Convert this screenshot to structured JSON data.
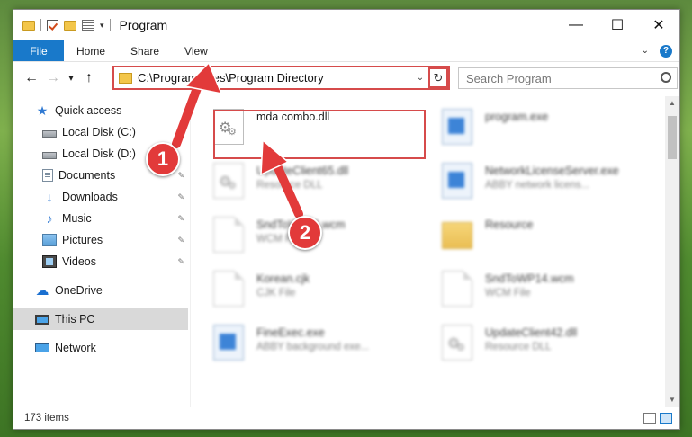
{
  "window": {
    "title": "Program"
  },
  "ribbon": {
    "file": "File",
    "tabs": [
      "Home",
      "Share",
      "View"
    ],
    "help": "?"
  },
  "titlebar": {
    "minimize": "—",
    "maximize": "☐",
    "close": "✕"
  },
  "nav": {
    "back": "←",
    "forward": "→",
    "recent": "▾",
    "up": "↑",
    "address_path": "C:\\Program Files\\Program Directory",
    "address_dropdown": "⌄",
    "refresh": "↻",
    "search_placeholder": "Search Program"
  },
  "sidebar": {
    "items": [
      {
        "label": "Quick access",
        "icon": "star-icon"
      },
      {
        "label": "Local Disk (C:)",
        "icon": "drive-icon"
      },
      {
        "label": "Local Disk (D:)",
        "icon": "drive-icon"
      },
      {
        "label": "Documents",
        "icon": "documents-icon",
        "pinned": true
      },
      {
        "label": "Downloads",
        "icon": "download-icon",
        "pinned": true
      },
      {
        "label": "Music",
        "icon": "music-icon",
        "pinned": true
      },
      {
        "label": "Pictures",
        "icon": "pictures-icon",
        "pinned": true
      },
      {
        "label": "Videos",
        "icon": "videos-icon",
        "pinned": true
      },
      {
        "label": "OneDrive",
        "icon": "cloud-icon"
      },
      {
        "label": "This PC",
        "icon": "computer-icon",
        "selected": true
      },
      {
        "label": "Network",
        "icon": "network-icon"
      }
    ],
    "pin_glyph": "📌"
  },
  "files": [
    {
      "name": "mda combo.dll",
      "sub": "",
      "icon": "gear",
      "blur": false
    },
    {
      "name": "program.exe",
      "sub": "",
      "icon": "exe",
      "blur": true
    },
    {
      "name": "UpdateClient65.dll",
      "sub": "Resource DLL",
      "icon": "gear",
      "blur": true
    },
    {
      "name": "NetworkLicenseServer.exe",
      "sub": "ABBY network licens...",
      "icon": "exe",
      "blur": true
    },
    {
      "name": "SndToWP14.wcm",
      "sub": "WCM File",
      "icon": "page",
      "blur": true
    },
    {
      "name": "Resource",
      "sub": "",
      "icon": "folder",
      "blur": true
    },
    {
      "name": "Korean.cjk",
      "sub": "CJK File",
      "icon": "page",
      "blur": true
    },
    {
      "name": "SndToWP14.wcm",
      "sub": "WCM File",
      "icon": "page",
      "blur": true
    },
    {
      "name": "FineExec.exe",
      "sub": "ABBY background exe...",
      "icon": "exe",
      "blur": true
    },
    {
      "name": "UpdateClient42.dll",
      "sub": "Resource DLL",
      "icon": "gear",
      "blur": true
    }
  ],
  "status": {
    "count": "173 items"
  },
  "annotations": {
    "badge1": "1",
    "badge2": "2"
  },
  "colors": {
    "accent": "#1979ca",
    "highlight": "#d64b4b",
    "badge": "#e23a3a"
  }
}
